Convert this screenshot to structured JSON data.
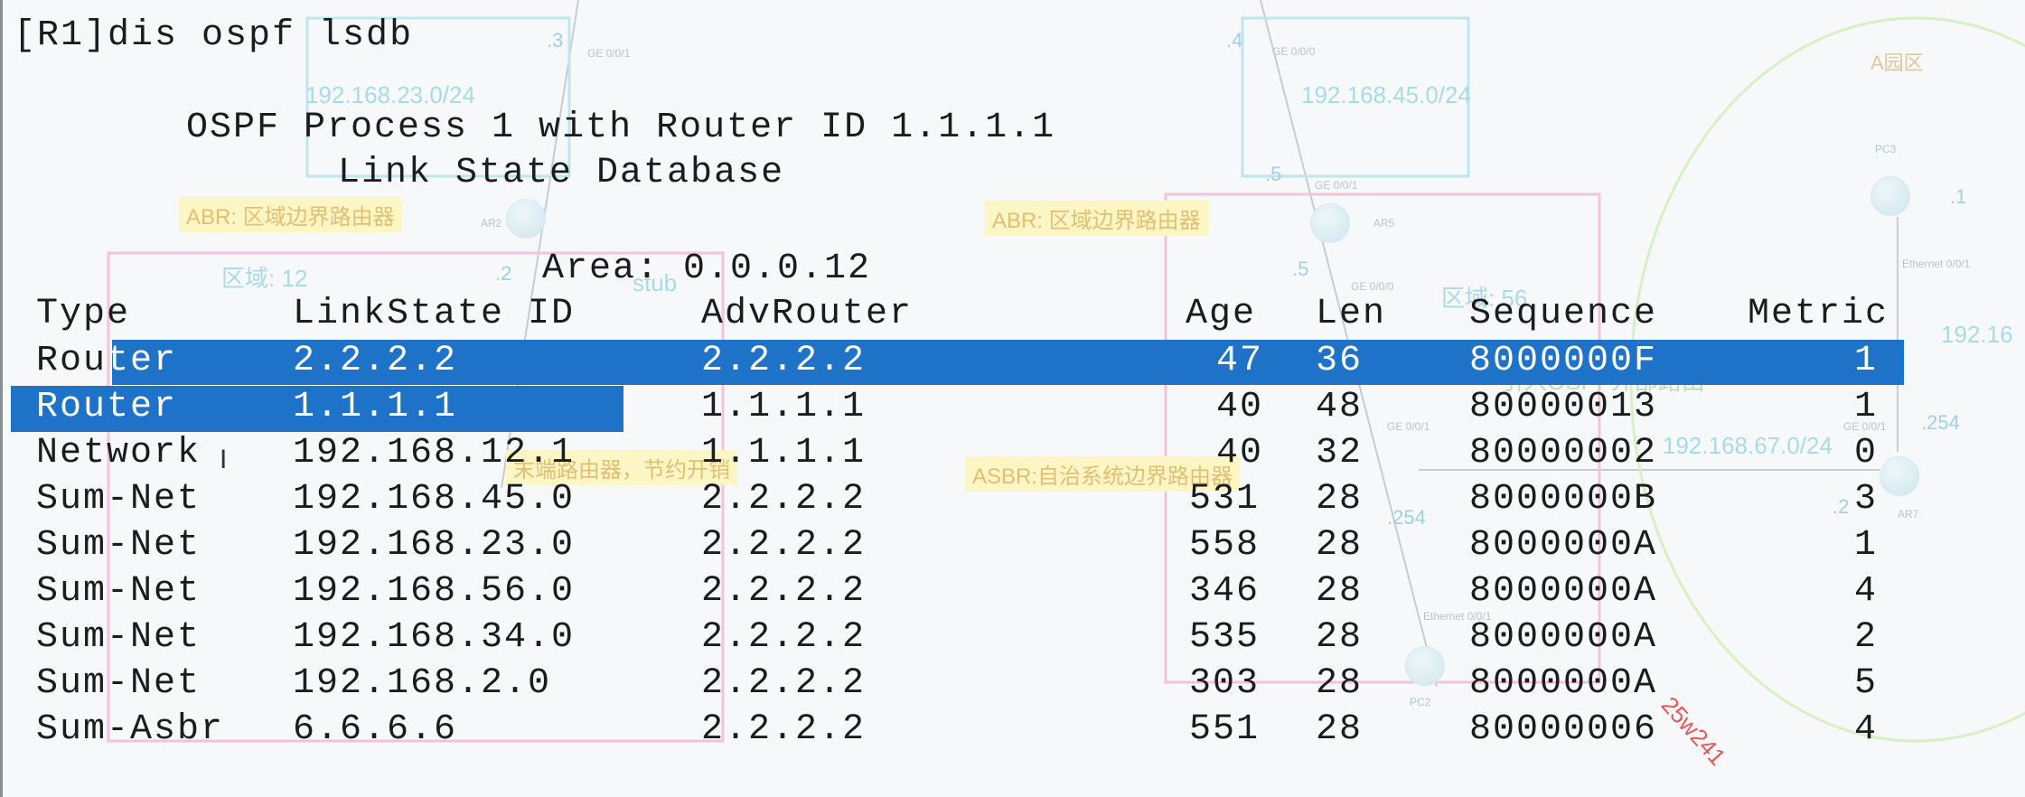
{
  "terminal": {
    "prompt": "[R1]",
    "command": "dis ospf lsdb",
    "header_line1": "OSPF Process 1 with Router ID 1.1.1.1",
    "header_line2": "Link State Database",
    "area_label": "Area: 0.0.0.12",
    "columns": [
      "Type",
      "LinkState ID",
      "AdvRouter",
      "Age",
      "Len",
      "Sequence",
      "Metric"
    ],
    "rows": [
      {
        "type": "Router",
        "id": "2.2.2.2",
        "adv": "2.2.2.2",
        "age": "47",
        "len": "36",
        "seq": "8000000F",
        "metric": "1"
      },
      {
        "type": "Router",
        "id": "1.1.1.1",
        "adv": "1.1.1.1",
        "age": "40",
        "len": "48",
        "seq": "80000013",
        "metric": "1"
      },
      {
        "type": "Network",
        "id": "192.168.12.1",
        "adv": "1.1.1.1",
        "age": "40",
        "len": "32",
        "seq": "80000002",
        "metric": "0"
      },
      {
        "type": "Sum-Net",
        "id": "192.168.45.0",
        "adv": "2.2.2.2",
        "age": "531",
        "len": "28",
        "seq": "8000000B",
        "metric": "3"
      },
      {
        "type": "Sum-Net",
        "id": "192.168.23.0",
        "adv": "2.2.2.2",
        "age": "558",
        "len": "28",
        "seq": "8000000A",
        "metric": "1"
      },
      {
        "type": "Sum-Net",
        "id": "192.168.56.0",
        "adv": "2.2.2.2",
        "age": "346",
        "len": "28",
        "seq": "8000000A",
        "metric": "4"
      },
      {
        "type": "Sum-Net",
        "id": "192.168.34.0",
        "adv": "2.2.2.2",
        "age": "535",
        "len": "28",
        "seq": "8000000A",
        "metric": "2"
      },
      {
        "type": "Sum-Net",
        "id": "192.168.2.0",
        "adv": "2.2.2.2",
        "age": "303",
        "len": "28",
        "seq": "8000000A",
        "metric": "5"
      },
      {
        "type": "Sum-Asbr",
        "id": "6.6.6.6",
        "adv": "2.2.2.2",
        "age": "551",
        "len": "28",
        "seq": "80000006",
        "metric": "4"
      }
    ]
  },
  "topology": {
    "networks": [
      "192.168.23.0/24",
      "192.168.45.0/24",
      "192.168.67.0/24",
      "192.16"
    ],
    "ips": [
      ".3",
      ".4",
      ".2",
      ".5",
      ".5",
      ".1",
      ".254",
      ".2",
      ".254"
    ],
    "tags": [
      "ABR: 区域边界路由器",
      "ABR: 区域边界路由器",
      "ASBR:自治系统边界路由器",
      "末端路由器，节约开销"
    ],
    "areas": [
      "区域: 12",
      "区域: 56",
      "A园区"
    ],
    "stub_label": "stub",
    "overlay_note": "引入OSPF外部路由",
    "device_labels": [
      "AR2",
      "AR5",
      "PC3",
      "AR7",
      "PC2"
    ],
    "ports": [
      "GE 0/0/1",
      "GE 0/0/0",
      "GE 0/0/1",
      "GE 0/0/0",
      "Ethernet 0/0/1",
      "GE 0/0/1",
      "GE 0/0/1",
      "Ethernet 0/0/1"
    ]
  },
  "watermark": "25w241"
}
